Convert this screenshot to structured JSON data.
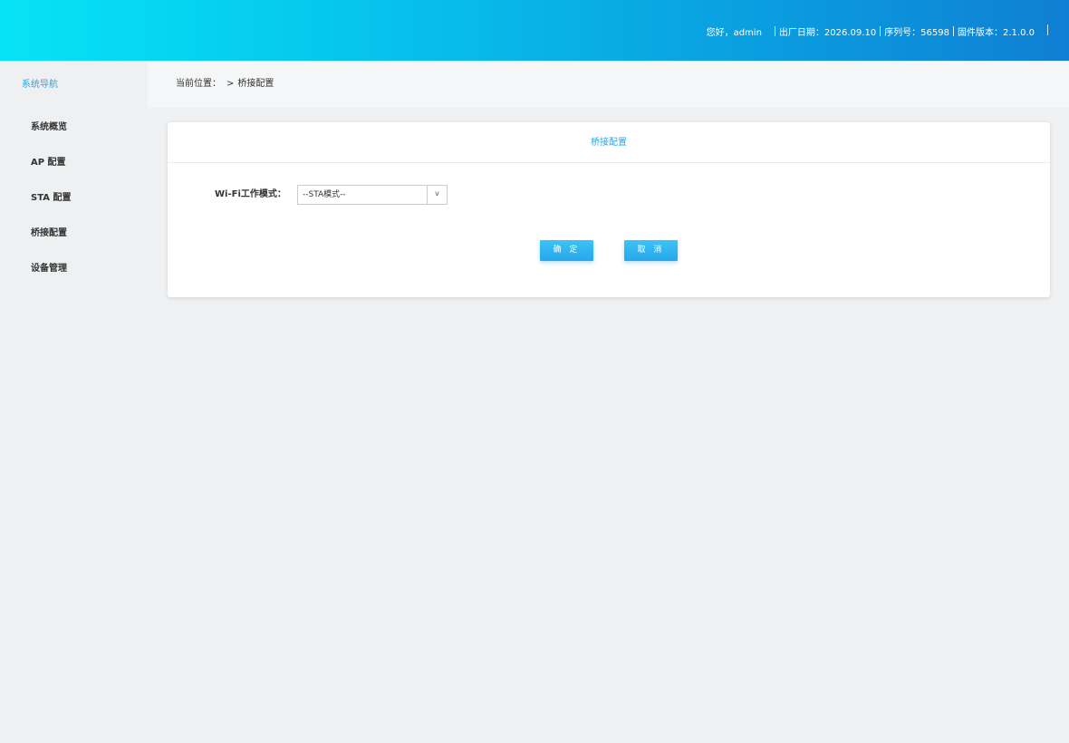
{
  "header": {
    "greeting": "您好，admin",
    "manufacture_date": "出厂日期：2026.09.10",
    "serial": "序列号：56598",
    "firmware": "固件版本：2.1.0.0"
  },
  "sidebar": {
    "title": "系统导航",
    "items": [
      {
        "label": "系统概览"
      },
      {
        "label": "AP 配置"
      },
      {
        "label": "STA 配置"
      },
      {
        "label": "桥接配置"
      },
      {
        "label": "设备管理"
      }
    ]
  },
  "breadcrumb": {
    "prefix": "当前位置：",
    "arrow": ">",
    "current": "桥接配置"
  },
  "panel": {
    "title": "桥接配置",
    "wifi_mode_label": "Wi-Fi工作模式：",
    "wifi_mode_value": "--STA模式--",
    "caret": "v",
    "ok_label": "确 定",
    "cancel_label": "取 消"
  },
  "colors": {
    "accent": "#2aa7e6",
    "header_start": "#06e3f5",
    "header_end": "#0f7fd3"
  }
}
